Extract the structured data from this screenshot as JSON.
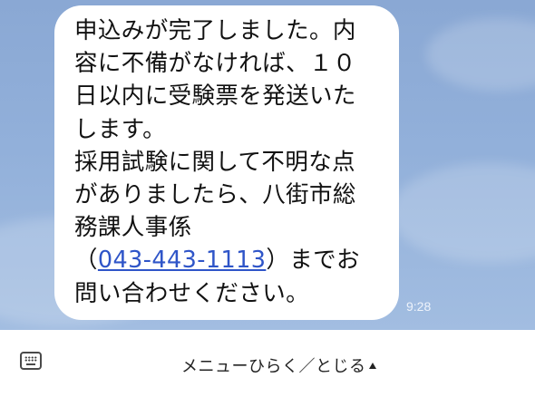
{
  "chat": {
    "message_lines": [
      "申込みが完了しました。内",
      "容に不備がなければ、１０",
      "日以内に受験票を発送いた",
      "します。",
      "採用試験に関して不明な点",
      "がありましたら、八街市総",
      "務課人事係"
    ],
    "phone_open": "（",
    "phone": "043-443-1113",
    "phone_close": "）までお",
    "last_line": "問い合わせください。",
    "time": "9:28"
  },
  "menu_bar": {
    "label": "メニューひらく／とじる",
    "keyboard_icon": "keyboard-icon",
    "toggle_icon": "triangle-up-icon"
  },
  "colors": {
    "chat_background": "#8aa8d4",
    "bubble": "#ffffff",
    "link": "#2f55c8"
  }
}
